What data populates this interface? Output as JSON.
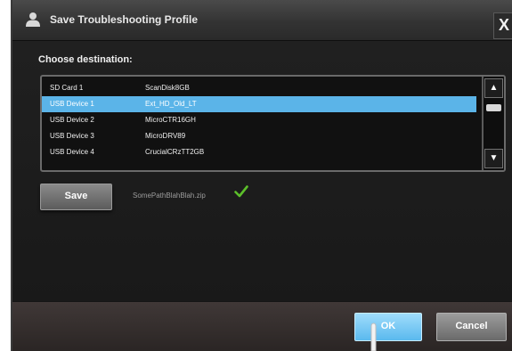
{
  "window": {
    "title": "Save Troubleshooting Profile",
    "close_label": "X",
    "icon": "user-profile-icon"
  },
  "destination": {
    "label": "Choose destination:",
    "items": [
      {
        "name": "SD Card 1",
        "device": "ScanDisk8GB",
        "selected": false
      },
      {
        "name": "USB Device 1",
        "device": "Ext_HD_Old_LT",
        "selected": true
      },
      {
        "name": "USB Device 2",
        "device": "MicroCTR16GH",
        "selected": false
      },
      {
        "name": "USB Device 3",
        "device": "MicroDRV89",
        "selected": false
      },
      {
        "name": "USB Device 4",
        "device": "CrucialCRzTT2GB",
        "selected": false
      }
    ],
    "scroll_up_icon": "triangle-up-icon",
    "scroll_down_icon": "triangle-down-icon"
  },
  "save": {
    "label": "Save",
    "filename": "SomePathBlahBlah.zip",
    "status_icon": "checkmark-icon",
    "status_color": "#5cbf2a"
  },
  "footer": {
    "ok_label": "OK",
    "cancel_label": "Cancel"
  },
  "colors": {
    "selection": "#5bb4e8",
    "ok_button": "#6cc3f2"
  }
}
